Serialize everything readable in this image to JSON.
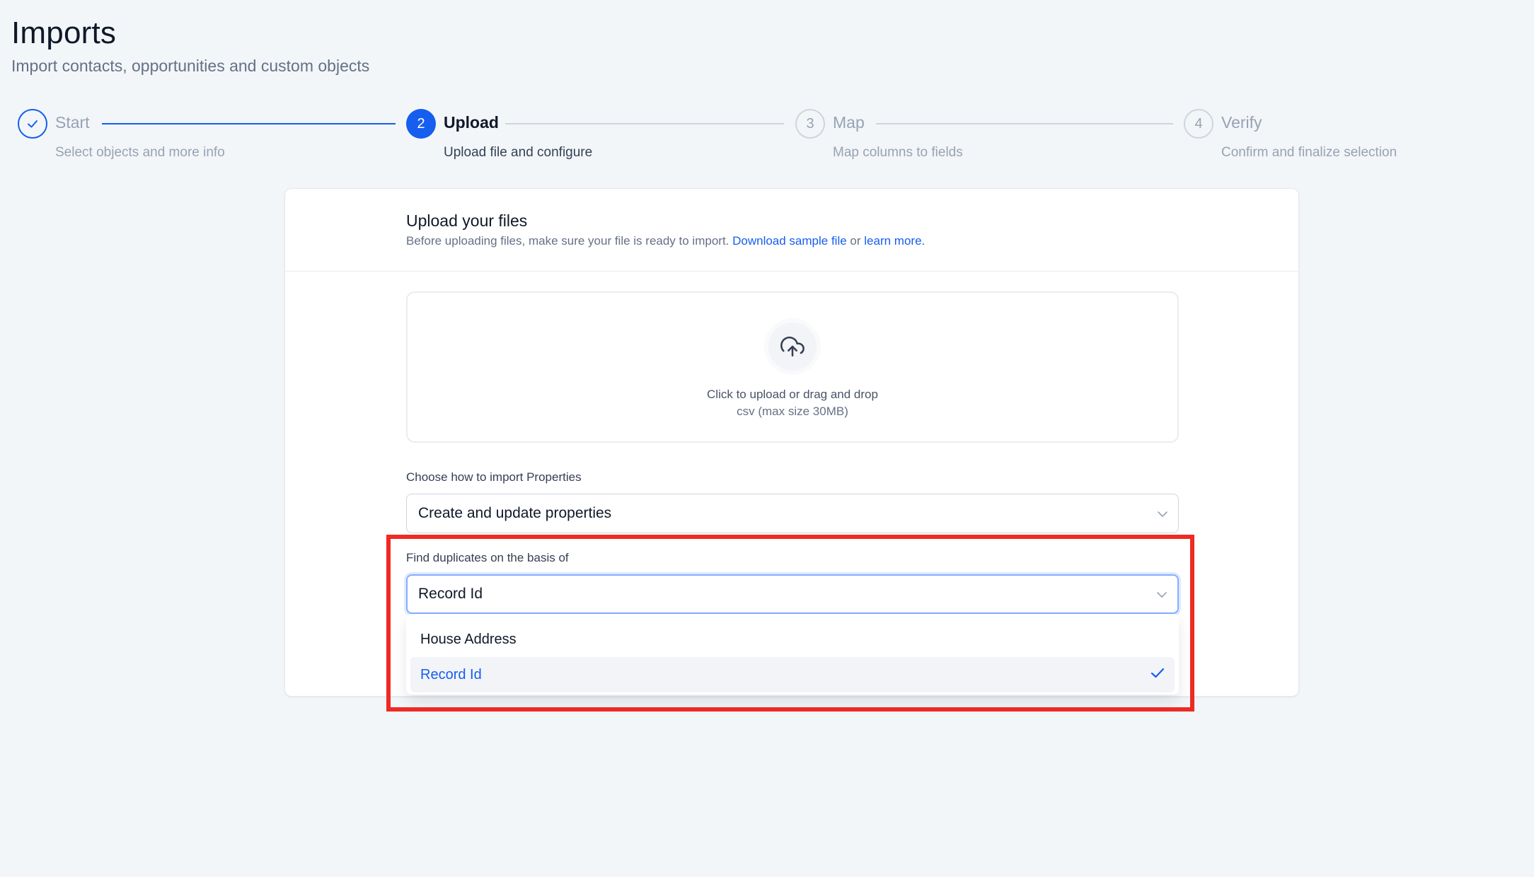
{
  "page": {
    "title": "Imports",
    "subtitle": "Import contacts, opportunities and custom objects"
  },
  "stepper": {
    "steps": [
      {
        "number": "",
        "label": "Start",
        "description": "Select objects and more info",
        "state": "done"
      },
      {
        "number": "2",
        "label": "Upload",
        "description": "Upload file and configure",
        "state": "active"
      },
      {
        "number": "3",
        "label": "Map",
        "description": "Map columns to fields",
        "state": "todo"
      },
      {
        "number": "4",
        "label": "Verify",
        "description": "Confirm and finalize selection",
        "state": "todo"
      }
    ]
  },
  "upload": {
    "title": "Upload your files",
    "help_prefix": "Before uploading files, make sure your file is ready to import. ",
    "sample_link": "Download sample file",
    "help_or": " or ",
    "learn_link": "learn more.",
    "drop_title": "Click to upload or drag and drop",
    "drop_subtitle": "csv (max size 30MB)"
  },
  "import_mode": {
    "label": "Choose how to import Properties",
    "value": "Create and update properties"
  },
  "duplicates": {
    "label": "Find duplicates on the basis of",
    "value": "Record Id",
    "options": [
      {
        "label": "House Address",
        "selected": false
      },
      {
        "label": "Record Id",
        "selected": true
      }
    ]
  },
  "colors": {
    "accent": "#155eef",
    "highlight": "#ee2a24",
    "background": "#f2f6f9"
  }
}
